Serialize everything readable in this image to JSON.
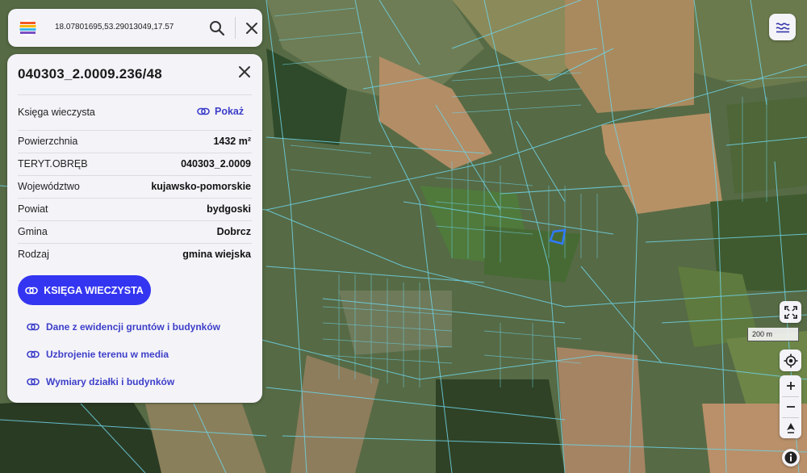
{
  "search": {
    "coordinates": "18.07801695,53.29013049,17.57"
  },
  "parcel": {
    "id": "040303_2.0009.236/48",
    "land_registry_label": "Księga wieczysta",
    "show_label": "Pokaż",
    "rows": [
      {
        "label": "Powierzchnia",
        "value": "1432 m²"
      },
      {
        "label": "TERYT.OBRĘB",
        "value": "040303_2.0009"
      },
      {
        "label": "Województwo",
        "value": "kujawsko-pomorskie"
      },
      {
        "label": "Powiat",
        "value": "bydgoski"
      },
      {
        "label": "Gmina",
        "value": "Dobrcz"
      },
      {
        "label": "Rodzaj",
        "value": "gmina wiejska"
      }
    ],
    "primary_button": "KSIĘGA WIECZYSTA",
    "links": [
      "Dane z ewidencji gruntów i budynków",
      "Uzbrojenie terenu w media",
      "Wymiary działki i budynków"
    ]
  },
  "map": {
    "scale_label": "200 m",
    "controls": [
      "layers-icon",
      "fullscreen-icon",
      "locate-icon",
      "zoom-in-icon",
      "zoom-out-icon",
      "compass-icon",
      "info-icon"
    ]
  },
  "colors": {
    "accent": "#3435f0",
    "link": "#3d3fc9",
    "parcel_lines": "#6fd3e6",
    "selected_parcel": "#2f7bff",
    "panel_bg": "#f4f3f8"
  }
}
